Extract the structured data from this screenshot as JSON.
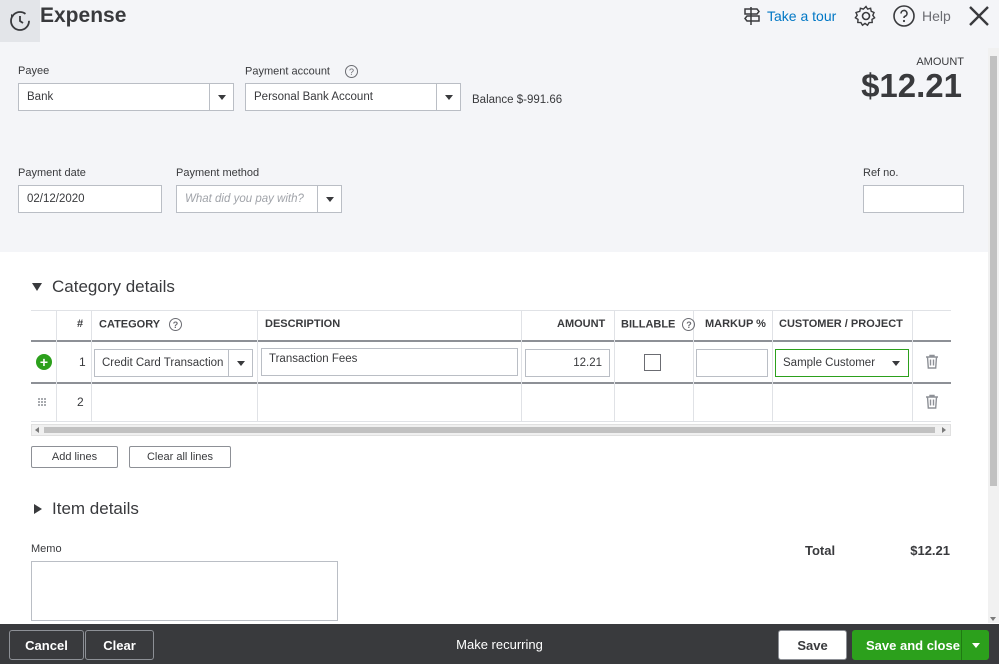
{
  "header": {
    "title": "Expense",
    "take_tour": "Take a tour",
    "help": "Help",
    "amount_label": "AMOUNT",
    "amount_value": "$12.21"
  },
  "form": {
    "payee_label": "Payee",
    "payee_value": "Bank",
    "payment_account_label": "Payment account",
    "payment_account_value": "Personal Bank Account",
    "balance_text": "Balance $-991.66",
    "payment_date_label": "Payment date",
    "payment_date_value": "02/12/2020",
    "payment_method_label": "Payment method",
    "payment_method_placeholder": "What did you pay with?",
    "ref_label": "Ref no.",
    "ref_value": ""
  },
  "category": {
    "title": "Category details",
    "columns": [
      "#",
      "CATEGORY",
      "DESCRIPTION",
      "AMOUNT",
      "BILLABLE",
      "MARKUP %",
      "CUSTOMER / PROJECT"
    ],
    "rows": [
      {
        "num": "1",
        "category": "Credit Card Transaction",
        "description": "Transaction Fees",
        "amount": "12.21",
        "markup": "",
        "customer": "Sample Customer"
      },
      {
        "num": "2"
      }
    ],
    "add_lines": "Add lines",
    "clear_all_lines": "Clear all lines"
  },
  "item": {
    "title": "Item details"
  },
  "memo": {
    "label": "Memo"
  },
  "total": {
    "label": "Total",
    "value": "$12.21"
  },
  "footer": {
    "cancel": "Cancel",
    "clear": "Clear",
    "make_recurring": "Make recurring",
    "save": "Save",
    "save_and_close": "Save and close"
  },
  "colors": {
    "accent_green": "#2ca01c",
    "link_blue": "#0077c5",
    "footer_bg": "#393a3d",
    "header_bg": "#f4f5f8"
  }
}
